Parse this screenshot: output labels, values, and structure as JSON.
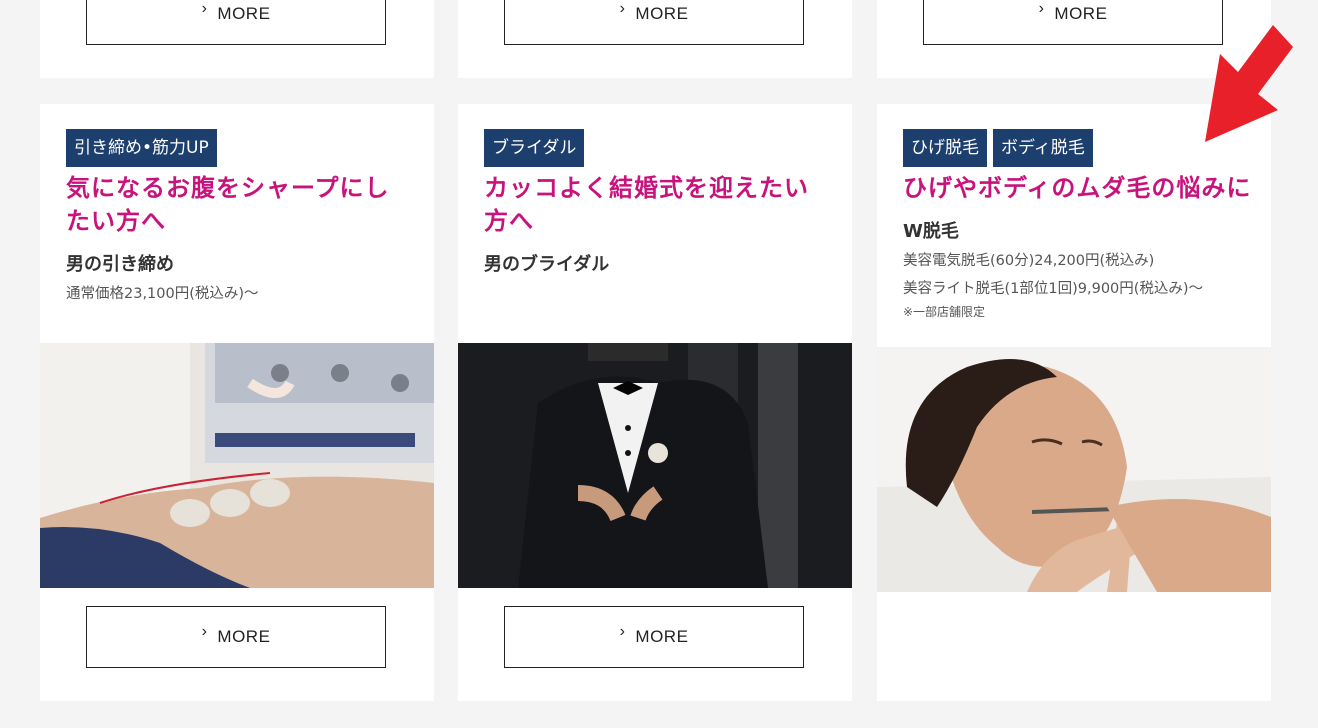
{
  "top_cards": [
    {
      "more_label": "MORE"
    },
    {
      "more_label": "MORE"
    },
    {
      "more_label": "MORE"
    }
  ],
  "cards": [
    {
      "tags": [
        "引き締め•筋力UP"
      ],
      "headline": "気になるお腹をシャープにしたい方へ",
      "subtitle": "男の引き締め",
      "prices": [
        "通常価格23,100円(税込み)〜"
      ],
      "note": "",
      "photo_icon": "ems-treatment-photo",
      "more_label": "MORE"
    },
    {
      "tags": [
        "ブライダル"
      ],
      "headline": "カッコよく結婚式を迎えたい方へ",
      "subtitle": "男のブライダル",
      "prices": [],
      "note": "",
      "photo_icon": "groom-tuxedo-photo",
      "more_label": "MORE"
    },
    {
      "tags": [
        "ひげ脱毛",
        "ボディ脱毛"
      ],
      "headline": "ひげやボディのムダ毛の悩みに",
      "subtitle": "W脱毛",
      "prices": [
        "美容電気脱毛(60分)24,200円(税込み)",
        "美容ライト脱毛(1部位1回)9,900円(税込み)〜"
      ],
      "note": "※一部店舗限定",
      "photo_icon": "facial-hair-removal-photo",
      "more_label": ""
    }
  ],
  "colors": {
    "accent": "#c8137d",
    "tag_bg": "#1d3f6e",
    "arrow": "#e8202a"
  }
}
